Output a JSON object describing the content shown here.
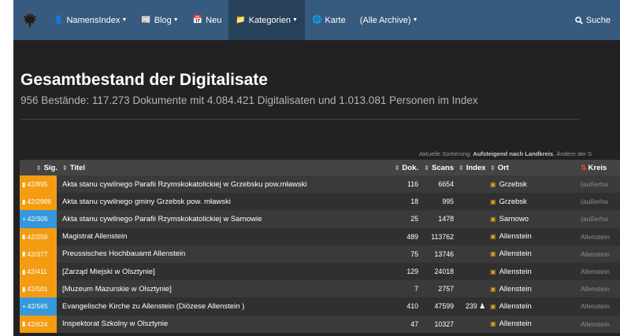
{
  "navbar": {
    "brand_icon": "eagle-coat-of-arms-icon",
    "items": [
      {
        "label": "NamensIndex",
        "icon": "user-icon",
        "dropdown": true
      },
      {
        "label": "Blog",
        "icon": "newspaper-icon",
        "dropdown": true
      },
      {
        "label": "Neu",
        "icon": "calendar-icon",
        "dropdown": false
      },
      {
        "label": "Kategorien",
        "icon": "folder-icon",
        "dropdown": true,
        "active": true
      },
      {
        "label": "Karte",
        "icon": "globe-icon",
        "dropdown": false
      },
      {
        "label": "(Alle Archive)",
        "icon": "",
        "dropdown": true
      }
    ],
    "search_label": "Suche",
    "colors": {
      "bar": "#375a7f",
      "active": "#28415b"
    }
  },
  "page": {
    "title": "Gesamtbestand der Digitalisate",
    "subtitle": "956 Bestände: 117.273 Dokumente mit 4.084.421 Digitalisaten und 1.013.081 Personen im Index",
    "sort_note_prefix": "Aktuelle Sortierung:",
    "sort_note_bold": "Aufsteigend nach Landkreis",
    "sort_note_suffix": ". Ändern der S"
  },
  "table": {
    "headers": {
      "sig": "Sig.",
      "titel": "Titel",
      "dok": "Dok.",
      "scans": "Scans",
      "index": "Index",
      "ort": "Ort",
      "kreis": "Kreis"
    },
    "colors": {
      "orange": "#f39c12",
      "blue": "#3498db",
      "header": "#444444"
    },
    "rows": [
      {
        "sig": "42/895",
        "sig_color": "orange",
        "sig_icon": "book-icon",
        "titel": "Akta stanu cywilnego Parafii Rzymskokatolickiej w Grzebsku pow.mławski",
        "dok": "116",
        "scans": "6654",
        "index": "",
        "ort": "Grzebsk",
        "kreis": "(außerha"
      },
      {
        "sig": "42/2986",
        "sig_color": "orange",
        "sig_icon": "book-icon",
        "titel": "Akta stanu cywilnego gminy Grzebsk pow. mławski",
        "dok": "18",
        "scans": "995",
        "index": "",
        "ort": "Grzebsk",
        "kreis": "(außerha"
      },
      {
        "sig": "42/305",
        "sig_color": "blue",
        "sig_icon": "plus-icon",
        "titel": "Akta stanu cywilnego Parafii Rzymskokatolickiej w Sarnowie",
        "dok": "25",
        "scans": "1478",
        "index": "",
        "ort": "Sarnowo",
        "kreis": "(außerha"
      },
      {
        "sig": "42/259",
        "sig_color": "orange",
        "sig_icon": "book-icon",
        "titel": "Magistrat Allenstein",
        "dok": "489",
        "scans": "113762",
        "index": "",
        "ort": "Allenstein",
        "kreis": "Allenstein"
      },
      {
        "sig": "42/377",
        "sig_color": "orange",
        "sig_icon": "book-icon",
        "titel": "Preussisches Hochbauamt Allenstein",
        "dok": "75",
        "scans": "13746",
        "index": "",
        "ort": "Allenstein",
        "kreis": "Allenstein"
      },
      {
        "sig": "42/411",
        "sig_color": "orange",
        "sig_icon": "book-icon",
        "titel": "[Zarząd Miejski w Olsztynie]",
        "dok": "129",
        "scans": "24018",
        "index": "",
        "ort": "Allenstein",
        "kreis": "Allenstein"
      },
      {
        "sig": "42/501",
        "sig_color": "orange",
        "sig_icon": "book-icon",
        "titel": "[Muzeum Mazurskie w Olsztynie]",
        "dok": "7",
        "scans": "2757",
        "index": "",
        "ort": "Allenstein",
        "kreis": "Allenstein"
      },
      {
        "sig": "42/565",
        "sig_color": "blue",
        "sig_icon": "plus-icon",
        "titel": "Evangelische Kirche zu Allenstein (Diözese Allenstein )",
        "dok": "410",
        "scans": "47599",
        "index": "239",
        "ort": "Allenstein",
        "kreis": "Allenstein"
      },
      {
        "sig": "42/624",
        "sig_color": "orange",
        "sig_icon": "book-icon",
        "titel": "Inspektorat Szkolny w Olsztynie",
        "dok": "47",
        "scans": "10327",
        "index": "",
        "ort": "Allenstein",
        "kreis": "Allenstein"
      }
    ]
  }
}
